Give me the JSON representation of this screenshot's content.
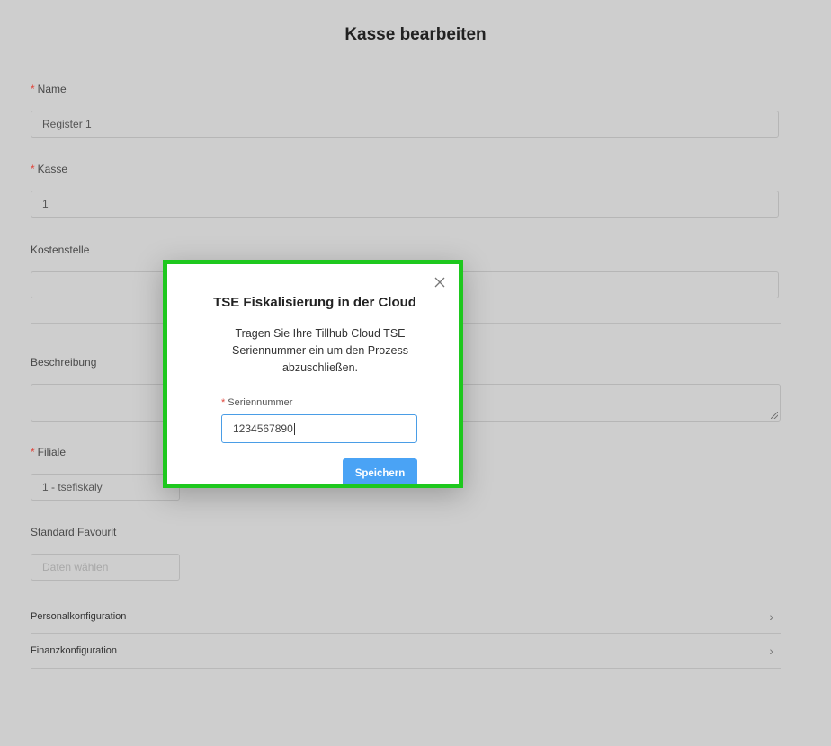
{
  "page": {
    "title": "Kasse bearbeiten"
  },
  "form": {
    "required_mark": "*",
    "name_label": "Name",
    "name_value": "Register 1",
    "kasse_label": "Kasse",
    "kasse_value": "1",
    "kostenstelle_label": "Kostenstelle",
    "kostenstelle_value": "",
    "beschreibung_label": "Beschreibung",
    "filiale_label": "Filiale",
    "filiale_value": "1 - tsefiskaly",
    "favourit_label": "Standard Favourit",
    "favourit_placeholder": "Daten wählen"
  },
  "sections": [
    {
      "label": "Personalkonfiguration"
    },
    {
      "label": "Finanzkonfiguration"
    }
  ],
  "modal": {
    "title": "TSE Fiskalisierung in der Cloud",
    "description": "Tragen Sie Ihre Tillhub Cloud TSE Seriennummer ein um den Prozess abzuschließen.",
    "serial_label": "Seriennummer",
    "serial_value": "1234567890",
    "save_label": "Speichern"
  },
  "colors": {
    "highlight": "#1ec81e",
    "primary": "#4aa3f5",
    "required": "#e0463c"
  },
  "icons": {
    "close": "close-icon",
    "chevron": "chevron-right-icon"
  }
}
